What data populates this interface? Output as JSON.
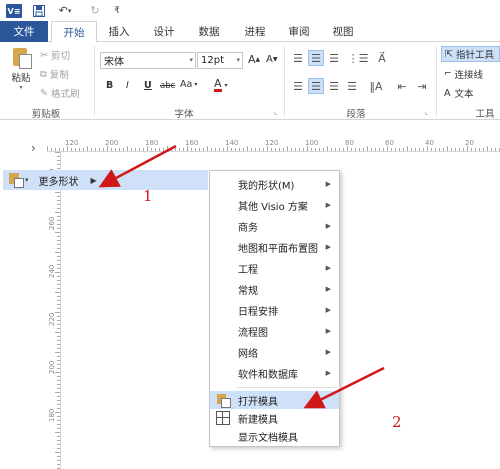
{
  "titlebar": {
    "logo_text": "V≡",
    "save_icon": "save-icon",
    "undo_icon": "undo-icon",
    "redo_icon": "redo-icon",
    "customize_icon": "customize-qat-icon"
  },
  "tabs": [
    "文件",
    "开始",
    "插入",
    "设计",
    "数据",
    "进程",
    "审阅",
    "视图"
  ],
  "active_tab": "开始",
  "ribbon": {
    "clipboard": {
      "paste": "粘贴",
      "cut": "剪切",
      "copy": "复制",
      "format_painter": "格式刷",
      "label": "剪贴板"
    },
    "font": {
      "font_name": "宋体",
      "font_size": "12pt",
      "grow": "A",
      "shrink": "A",
      "bold": "B",
      "italic": "I",
      "underline": "U",
      "strike": "abc",
      "case": "Aa",
      "color": "A",
      "label": "字体"
    },
    "paragraph": {
      "label": "段落"
    },
    "tools": {
      "pointer": "指针工具",
      "connector": "连接线",
      "text": "文本",
      "label": "工具"
    }
  },
  "ruler": {
    "h_labels": [
      "120",
      "200",
      "180",
      "160",
      "140",
      "120",
      "100",
      "80",
      "60",
      "40",
      "20"
    ],
    "v_labels": [
      "280",
      "260",
      "240",
      "220",
      "200",
      "180"
    ]
  },
  "shapes_pane": {
    "more_shapes": "更多形状"
  },
  "context_menu": {
    "items": [
      {
        "label": "我的形状(M)",
        "submenu": true
      },
      {
        "label": "其他 Visio 方案",
        "submenu": true
      },
      {
        "label": "商务",
        "submenu": true
      },
      {
        "label": "地图和平面布置图",
        "submenu": true
      },
      {
        "label": "工程",
        "submenu": true
      },
      {
        "label": "常规",
        "submenu": true
      },
      {
        "label": "日程安排",
        "submenu": true
      },
      {
        "label": "流程图",
        "submenu": true
      },
      {
        "label": "网络",
        "submenu": true
      },
      {
        "label": "软件和数据库",
        "submenu": true
      }
    ],
    "actions": [
      {
        "label": "打开模具",
        "icon": "open-stencil-icon"
      },
      {
        "label": "新建模具",
        "icon": "new-stencil-icon"
      },
      {
        "label": "显示文档模具",
        "icon": ""
      }
    ]
  },
  "annotations": {
    "step1": "1",
    "step2": "2",
    "arrow_color": "#d01818"
  }
}
